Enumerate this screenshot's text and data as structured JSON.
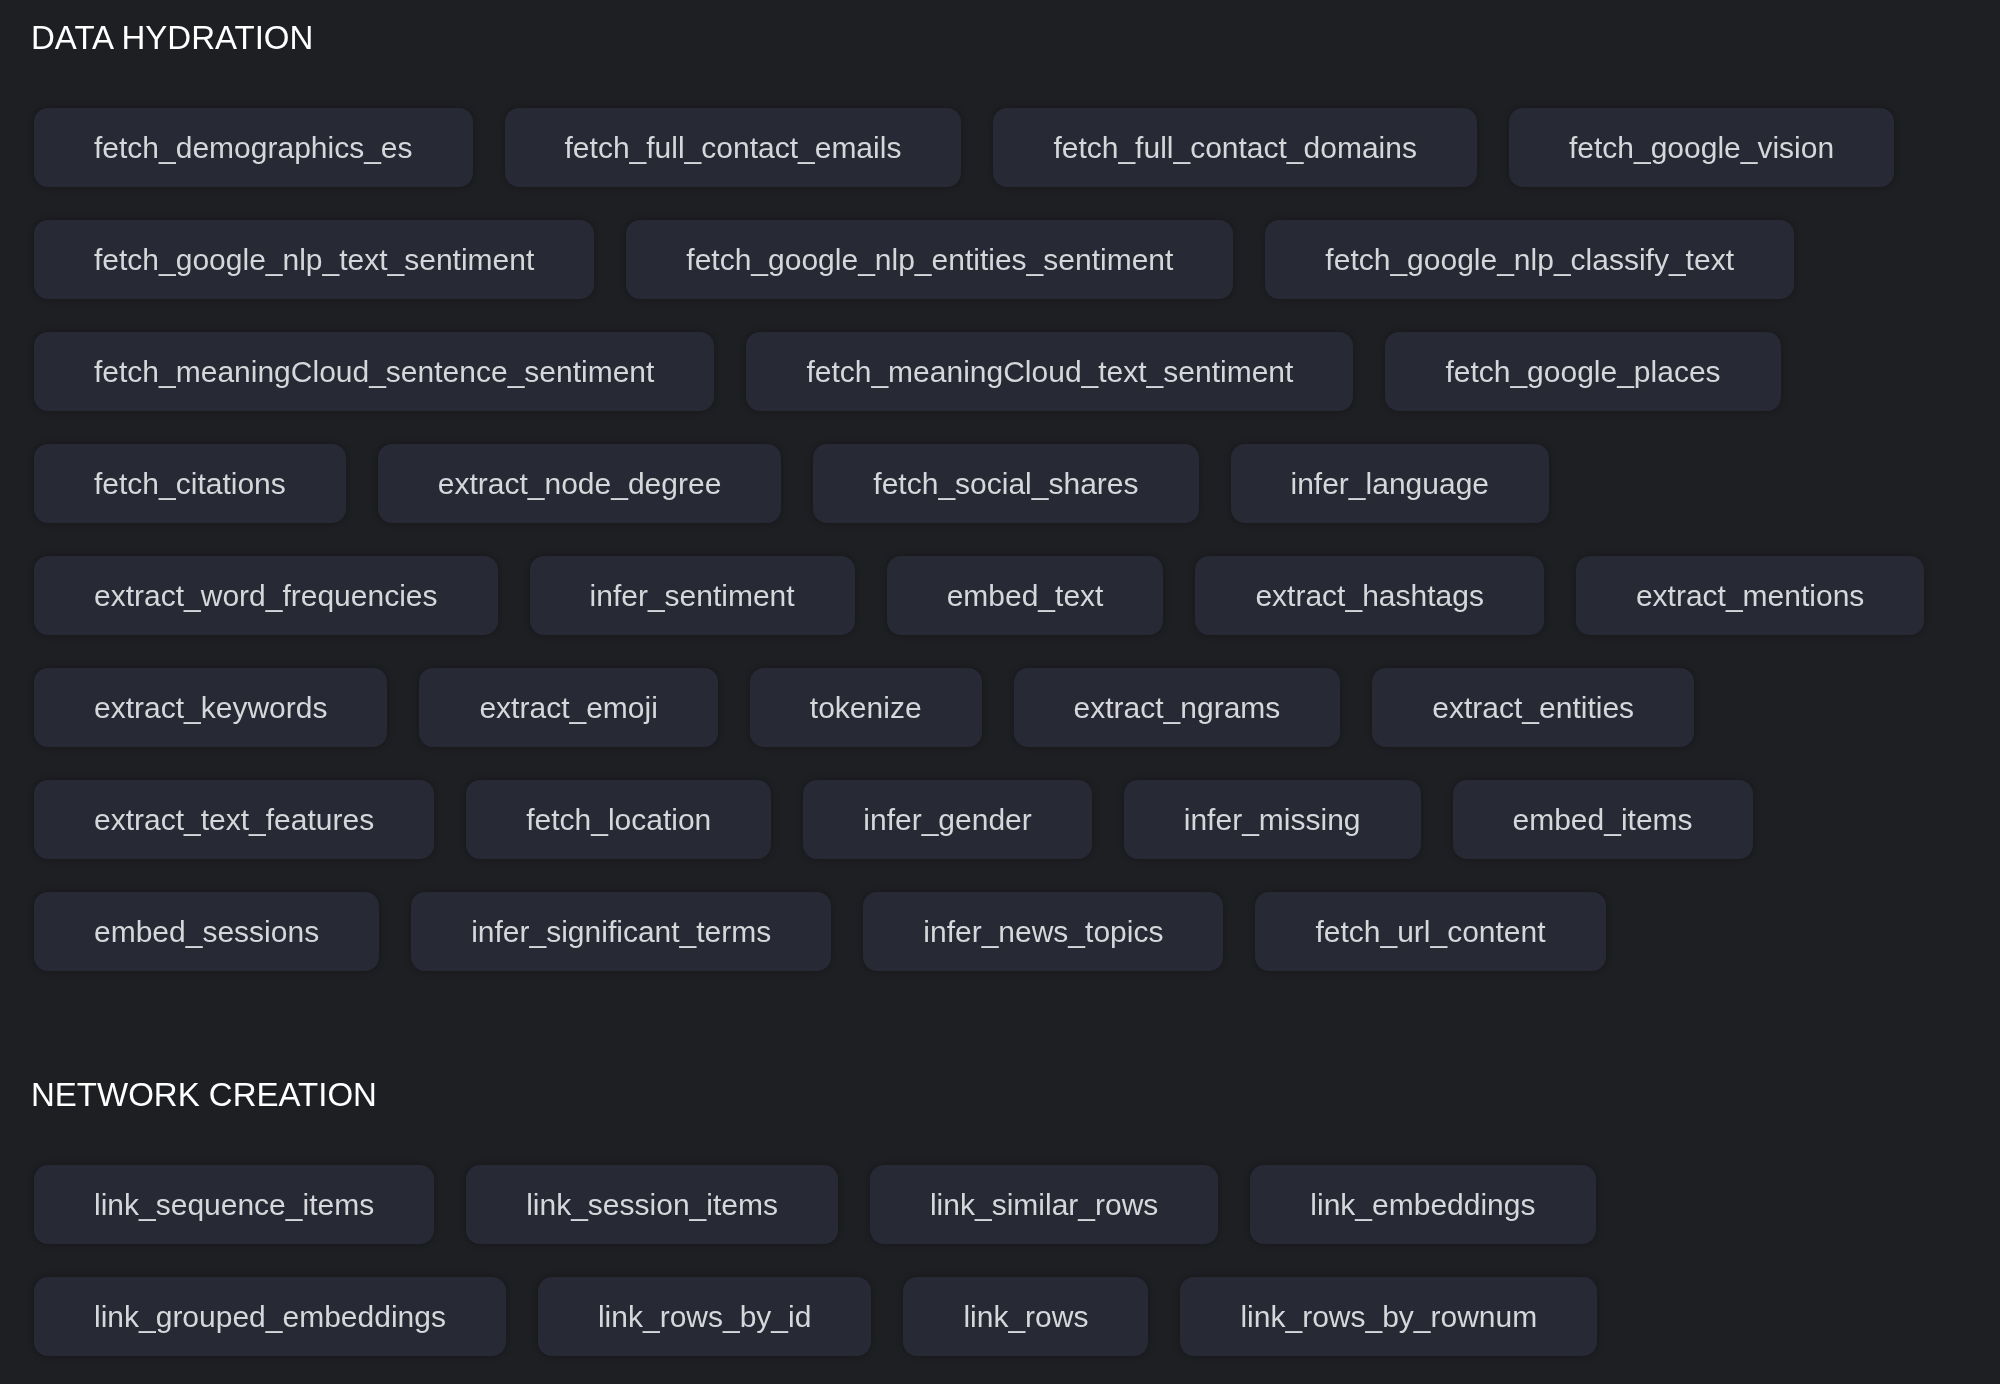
{
  "sections": [
    {
      "title": "DATA HYDRATION",
      "chips": [
        "fetch_demographics_es",
        "fetch_full_contact_emails",
        "fetch_full_contact_domains",
        "fetch_google_vision",
        "fetch_google_nlp_text_sentiment",
        "fetch_google_nlp_entities_sentiment",
        "fetch_google_nlp_classify_text",
        "fetch_meaningCloud_sentence_sentiment",
        "fetch_meaningCloud_text_sentiment",
        "fetch_google_places",
        "fetch_citations",
        "extract_node_degree",
        "fetch_social_shares",
        "infer_language",
        "extract_word_frequencies",
        "infer_sentiment",
        "embed_text",
        "extract_hashtags",
        "extract_mentions",
        "extract_keywords",
        "extract_emoji",
        "tokenize",
        "extract_ngrams",
        "extract_entities",
        "extract_text_features",
        "fetch_location",
        "infer_gender",
        "infer_missing",
        "embed_items",
        "embed_sessions",
        "infer_significant_terms",
        "infer_news_topics",
        "fetch_url_content"
      ]
    },
    {
      "title": "NETWORK CREATION",
      "chips": [
        "link_sequence_items",
        "link_session_items",
        "link_similar_rows",
        "link_embeddings",
        "link_grouped_embeddings",
        "link_rows_by_id",
        "link_rows",
        "link_rows_by_rownum"
      ]
    }
  ]
}
